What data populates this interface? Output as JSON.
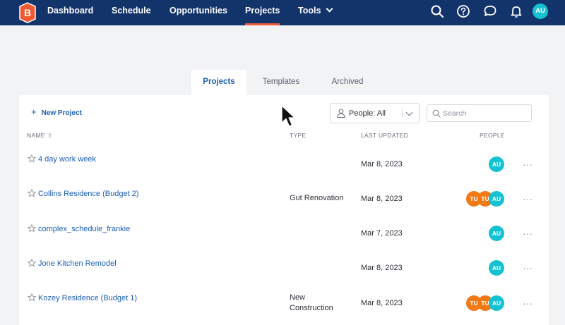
{
  "topnav": {
    "logo_letter": "B",
    "items": [
      {
        "label": "Dashboard"
      },
      {
        "label": "Schedule"
      },
      {
        "label": "Opportunities"
      },
      {
        "label": "Projects"
      },
      {
        "label": "Tools"
      }
    ],
    "active_item": "Projects",
    "icons": [
      "search-icon",
      "help-icon",
      "chat-icon",
      "bell-icon"
    ],
    "user_initials": "AU"
  },
  "tabs": [
    {
      "label": "Projects",
      "active": true
    },
    {
      "label": "Templates",
      "active": false
    },
    {
      "label": "Archived",
      "active": false
    }
  ],
  "toolbar": {
    "new_project_label": "New Project",
    "people_filter_label": "People: All",
    "search_placeholder": "Search"
  },
  "columns": {
    "name": "NAME",
    "type": "TYPE",
    "last_updated": "LAST UPDATED",
    "people": "PEOPLE"
  },
  "rows": [
    {
      "name": "4 day work week",
      "type": "",
      "last_updated": "Mar 8, 2023",
      "people": [
        "AU"
      ]
    },
    {
      "name": "Collins Residence (Budget 2)",
      "type": "Gut Renovation",
      "last_updated": "Mar 8, 2023",
      "people": [
        "TU",
        "TU",
        "AU"
      ]
    },
    {
      "name": "complex_schedule_frankie",
      "type": "",
      "last_updated": "Mar 7, 2023",
      "people": [
        "AU"
      ]
    },
    {
      "name": "Jone Kitchen Remodel",
      "type": "",
      "last_updated": "Mar 8, 2023",
      "people": [
        "AU"
      ]
    },
    {
      "name": "Kozey Residence (Budget 1)",
      "type_line1": "New",
      "type_line2": "Construction",
      "last_updated": "Mar 8, 2023",
      "people": [
        "TU",
        "TU",
        "AU"
      ]
    }
  ],
  "more_label": "···",
  "sort_arrow": "⇧",
  "colors": {
    "nav_bg": "#13336b",
    "accent_orange": "#ee5a34",
    "link_blue": "#1d5fb3",
    "avatar_teal": "#14c2d1",
    "avatar_orange": "#f07a17"
  }
}
